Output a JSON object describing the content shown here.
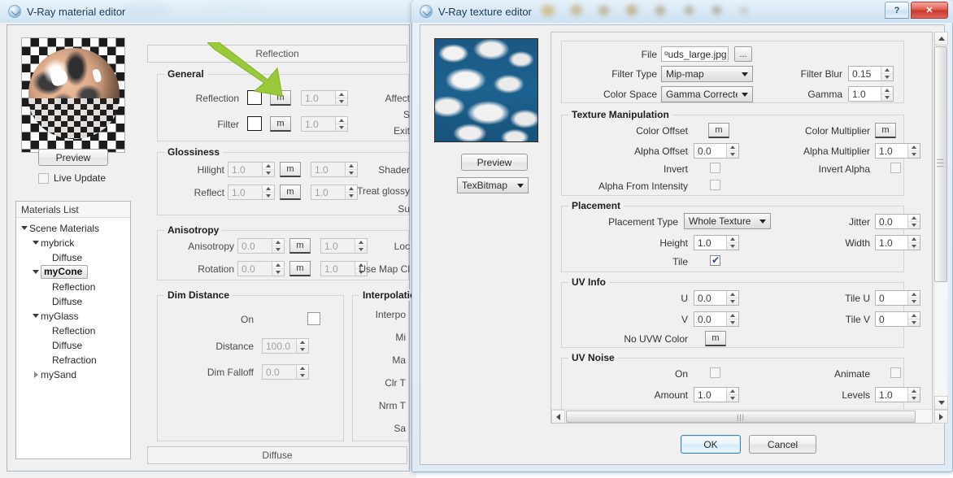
{
  "material_editor": {
    "title": "V-Ray material editor",
    "preview_button": "Preview",
    "live_update_label": "Live Update",
    "live_update_checked": false,
    "materials_list": {
      "header": "Materials List",
      "nodes": [
        {
          "label": "Scene Materials",
          "depth": 0,
          "twisty": "open",
          "selected": false
        },
        {
          "label": "mybrick",
          "depth": 1,
          "twisty": "open",
          "selected": false
        },
        {
          "label": "Diffuse",
          "depth": 2,
          "twisty": "none",
          "selected": false
        },
        {
          "label": "myCone",
          "depth": 1,
          "twisty": "open",
          "selected": true
        },
        {
          "label": "Reflection",
          "depth": 2,
          "twisty": "none",
          "selected": false
        },
        {
          "label": "Diffuse",
          "depth": 2,
          "twisty": "none",
          "selected": false
        },
        {
          "label": "myGlass",
          "depth": 1,
          "twisty": "open",
          "selected": false
        },
        {
          "label": "Reflection",
          "depth": 2,
          "twisty": "none",
          "selected": false
        },
        {
          "label": "Diffuse",
          "depth": 2,
          "twisty": "none",
          "selected": false
        },
        {
          "label": "Refraction",
          "depth": 2,
          "twisty": "none",
          "selected": false
        },
        {
          "label": "mySand",
          "depth": 1,
          "twisty": "closed",
          "selected": false
        }
      ]
    },
    "tab_top": "Reflection",
    "tab_bottom": "Diffuse",
    "groups": {
      "general": {
        "title": "General",
        "rows": [
          {
            "label": "Reflection",
            "map_btn": "m",
            "amount": "1.0"
          },
          {
            "label": "Filter",
            "map_btn": "m",
            "amount": "1.0"
          }
        ],
        "right_labels": [
          "Affect",
          "S",
          "Exit"
        ]
      },
      "glossiness": {
        "title": "Glossiness",
        "rows": [
          {
            "label": "Hilight",
            "value": "1.0",
            "map_btn": "m",
            "amount": "1.0"
          },
          {
            "label": "Reflect",
            "value": "1.0",
            "map_btn": "m",
            "amount": "1.0"
          }
        ],
        "right_labels": [
          "Shader",
          "Treat glossy",
          "Su"
        ]
      },
      "anisotropy": {
        "title": "Anisotropy",
        "rows": [
          {
            "label": "Anisotropy",
            "value": "0.0",
            "map_btn": "m",
            "amount": "1.0",
            "right": "Loc"
          },
          {
            "label": "Rotation",
            "value": "0.0",
            "map_btn": "m",
            "amount": "1.0",
            "right": "Use Map Cl"
          }
        ]
      },
      "dim_distance": {
        "title": "Dim Distance",
        "on_label": "On",
        "on_checked": false,
        "rows": [
          {
            "label": "Distance",
            "value": "100.0"
          },
          {
            "label": "Dim Falloff",
            "value": "0.0"
          }
        ]
      },
      "interpolation": {
        "title": "Interpolation",
        "right_labels": [
          "Interpo",
          "Mi",
          "Ma",
          "Clr T",
          "Nrm T",
          "Sa"
        ]
      }
    },
    "annotation": {
      "type": "arrow",
      "color": "#9ac93a",
      "points_at": "reflection-map-button"
    }
  },
  "texture_editor": {
    "title": "V-Ray texture editor",
    "help_button": "?",
    "close_button": "✕",
    "preview_button": "Preview",
    "texture_type": "TexBitmap",
    "bitmap": {
      "file_label": "File",
      "file_value": "ᵒuds_large.jpg",
      "browse_label": "...",
      "filter_type_label": "Filter Type",
      "filter_type_value": "Mip-map",
      "filter_blur_label": "Filter Blur",
      "filter_blur_value": "0.15",
      "color_space_label": "Color Space",
      "color_space_value": "Gamma Correcte",
      "gamma_label": "Gamma",
      "gamma_value": "1.0"
    },
    "texture_manipulation": {
      "title": "Texture Manipulation",
      "color_offset_label": "Color Offset",
      "color_offset_btn": "m",
      "color_multiplier_label": "Color Multiplier",
      "color_multiplier_btn": "m",
      "alpha_offset_label": "Alpha Offset",
      "alpha_offset_value": "0.0",
      "alpha_multiplier_label": "Alpha Multiplier",
      "alpha_multiplier_value": "1.0",
      "invert_label": "Invert",
      "invert_checked": false,
      "invert_alpha_label": "Invert Alpha",
      "invert_alpha_checked": false,
      "alpha_from_intensity_label": "Alpha From Intensity",
      "alpha_from_intensity_checked": false
    },
    "placement": {
      "title": "Placement",
      "placement_type_label": "Placement Type",
      "placement_type_value": "Whole Texture",
      "jitter_label": "Jitter",
      "jitter_value": "0.0",
      "height_label": "Height",
      "height_value": "1.0",
      "width_label": "Width",
      "width_value": "1.0",
      "tile_label": "Tile",
      "tile_checked": true
    },
    "uv_info": {
      "title": "UV Info",
      "u_label": "U",
      "u_value": "0.0",
      "tile_u_label": "Tile U",
      "tile_u_value": "0",
      "v_label": "V",
      "v_value": "0.0",
      "tile_v_label": "Tile V",
      "tile_v_value": "0",
      "no_uvw_color_label": "No UVW Color",
      "no_uvw_color_btn": "m"
    },
    "uv_noise": {
      "title": "UV Noise",
      "on_label": "On",
      "on_checked": false,
      "animate_label": "Animate",
      "animate_checked": false,
      "amount_label": "Amount",
      "amount_value": "1.0",
      "levels_label": "Levels",
      "levels_value": "1.0"
    },
    "footer": {
      "ok_label": "OK",
      "cancel_label": "Cancel"
    }
  },
  "colors": {
    "accent": "#3c7fb1",
    "close_red": "#c9382c",
    "arrow_green": "#9ac93a",
    "window_bg": "#f0f0f0"
  }
}
